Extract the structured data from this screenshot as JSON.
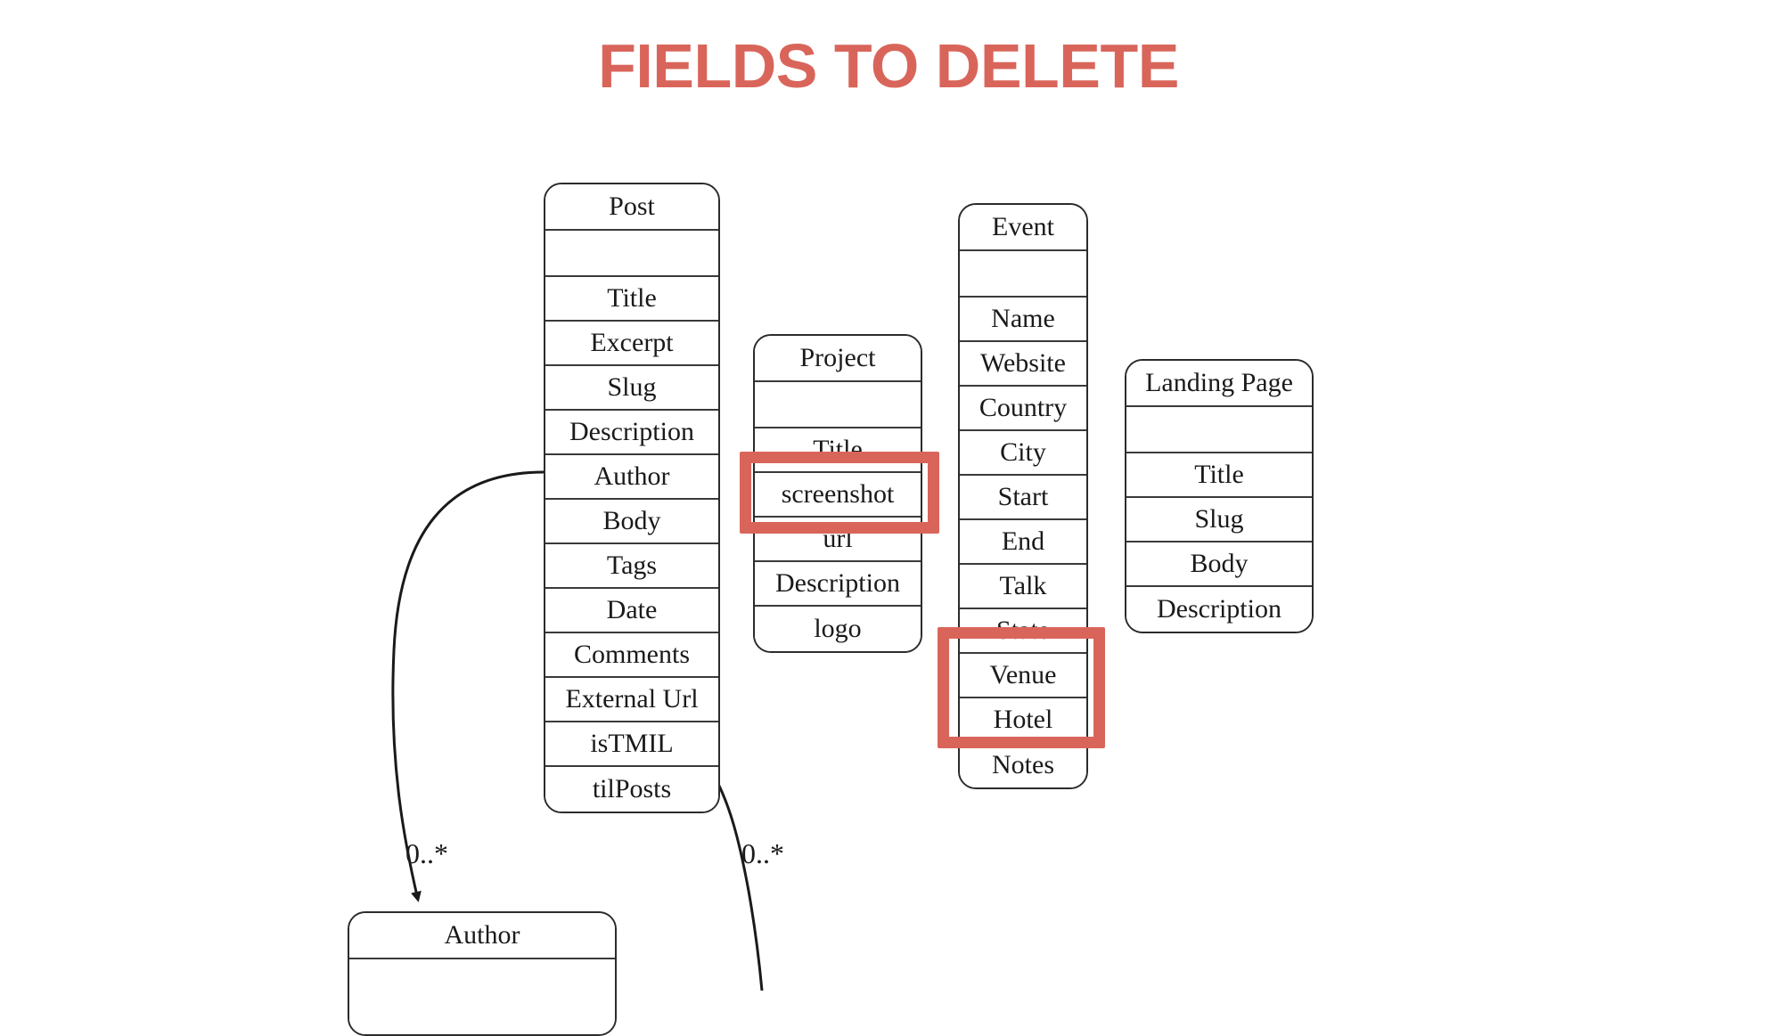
{
  "slide": {
    "title": "FIELDS TO DELETE",
    "background_color": "#ffffff",
    "accent_color": "#d9655a",
    "line_color": "#2b2b2b"
  },
  "classes": {
    "post": {
      "name": "Post",
      "fields": [
        "Title",
        "Excerpt",
        "Slug",
        "Description",
        "Author",
        "Body",
        "Tags",
        "Date",
        "Comments",
        "External Url",
        "isTMIL",
        "tilPosts"
      ]
    },
    "project": {
      "name": "Project",
      "fields": [
        "Title",
        "screenshot",
        "url",
        "Description",
        "logo"
      ]
    },
    "event": {
      "name": "Event",
      "fields": [
        "Name",
        "Website",
        "Country",
        "City",
        "Start",
        "End",
        "Talk",
        "State",
        "Venue",
        "Hotel",
        "Notes"
      ]
    },
    "landing_page": {
      "name": "Landing Page",
      "fields": [
        "Title",
        "Slug",
        "Body",
        "Description"
      ]
    },
    "author": {
      "name": "Author",
      "fields": []
    }
  },
  "highlights": [
    {
      "id": "screenshot-highlight",
      "target": "Project.screenshot"
    },
    {
      "id": "venue-hotel-highlight",
      "target": "Event.Venue,Event.Hotel"
    }
  ],
  "associations": [
    {
      "id": "post-author-association",
      "multiplicity": "0..*",
      "from": "Post.Author",
      "to": "Author"
    },
    {
      "id": "post-tilposts-association",
      "multiplicity": "0..*",
      "from": "Post.tilPosts",
      "to": ""
    }
  ]
}
